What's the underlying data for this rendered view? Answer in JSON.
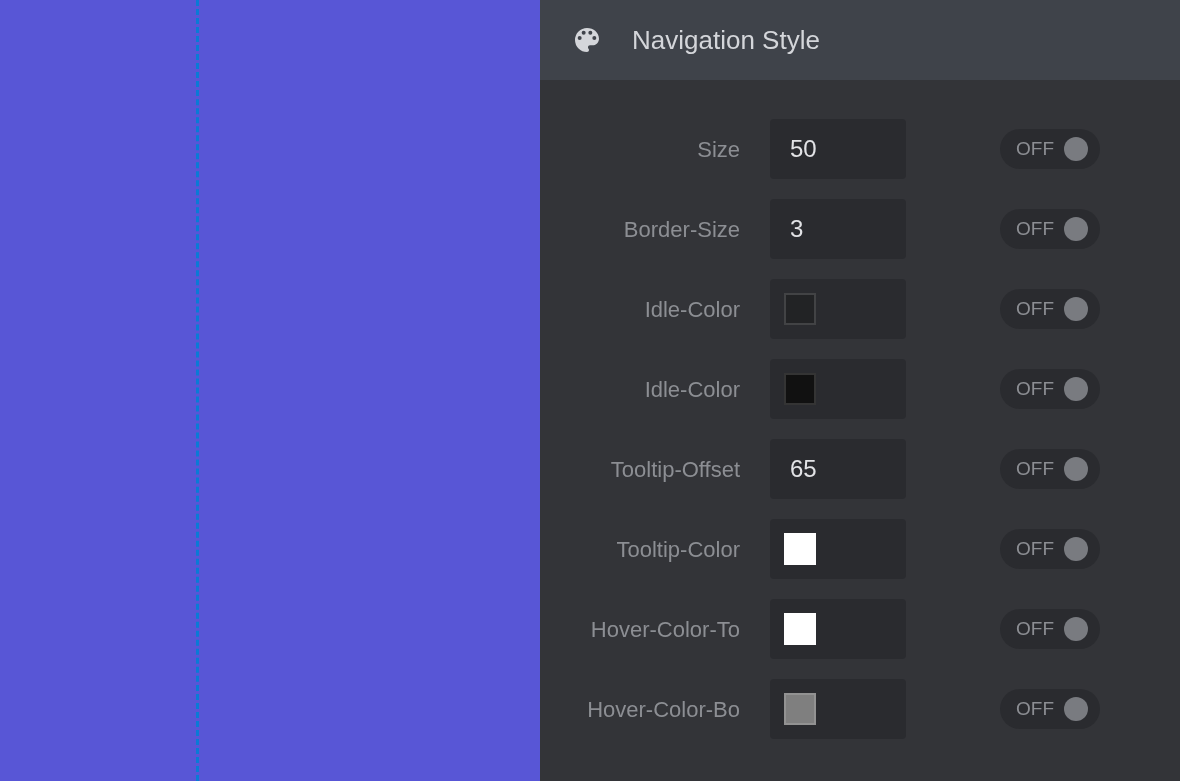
{
  "panel": {
    "title": "Navigation Style"
  },
  "rows": [
    {
      "label": "Size",
      "kind": "number",
      "value": "50",
      "toggle": {
        "text": "OFF",
        "on": false
      }
    },
    {
      "label": "Border-Size",
      "kind": "number",
      "value": "3",
      "toggle": {
        "text": "OFF",
        "on": false
      }
    },
    {
      "label": "Idle-Color",
      "kind": "color",
      "color": "#222325",
      "toggle": {
        "text": "OFF",
        "on": false
      }
    },
    {
      "label": "Idle-Color",
      "kind": "color",
      "color": "#111111",
      "toggle": {
        "text": "OFF",
        "on": false
      }
    },
    {
      "label": "Tooltip-Offset",
      "kind": "number",
      "value": "65",
      "toggle": {
        "text": "OFF",
        "on": false
      }
    },
    {
      "label": "Tooltip-Color",
      "kind": "color",
      "color": "#ffffff",
      "toggle": {
        "text": "OFF",
        "on": false
      }
    },
    {
      "label": "Hover-Color-To",
      "kind": "color",
      "color": "#ffffff",
      "toggle": {
        "text": "OFF",
        "on": false
      }
    },
    {
      "label": "Hover-Color-Bo",
      "kind": "color",
      "color": "#7f7f7f",
      "toggle": {
        "text": "OFF",
        "on": false
      }
    }
  ]
}
